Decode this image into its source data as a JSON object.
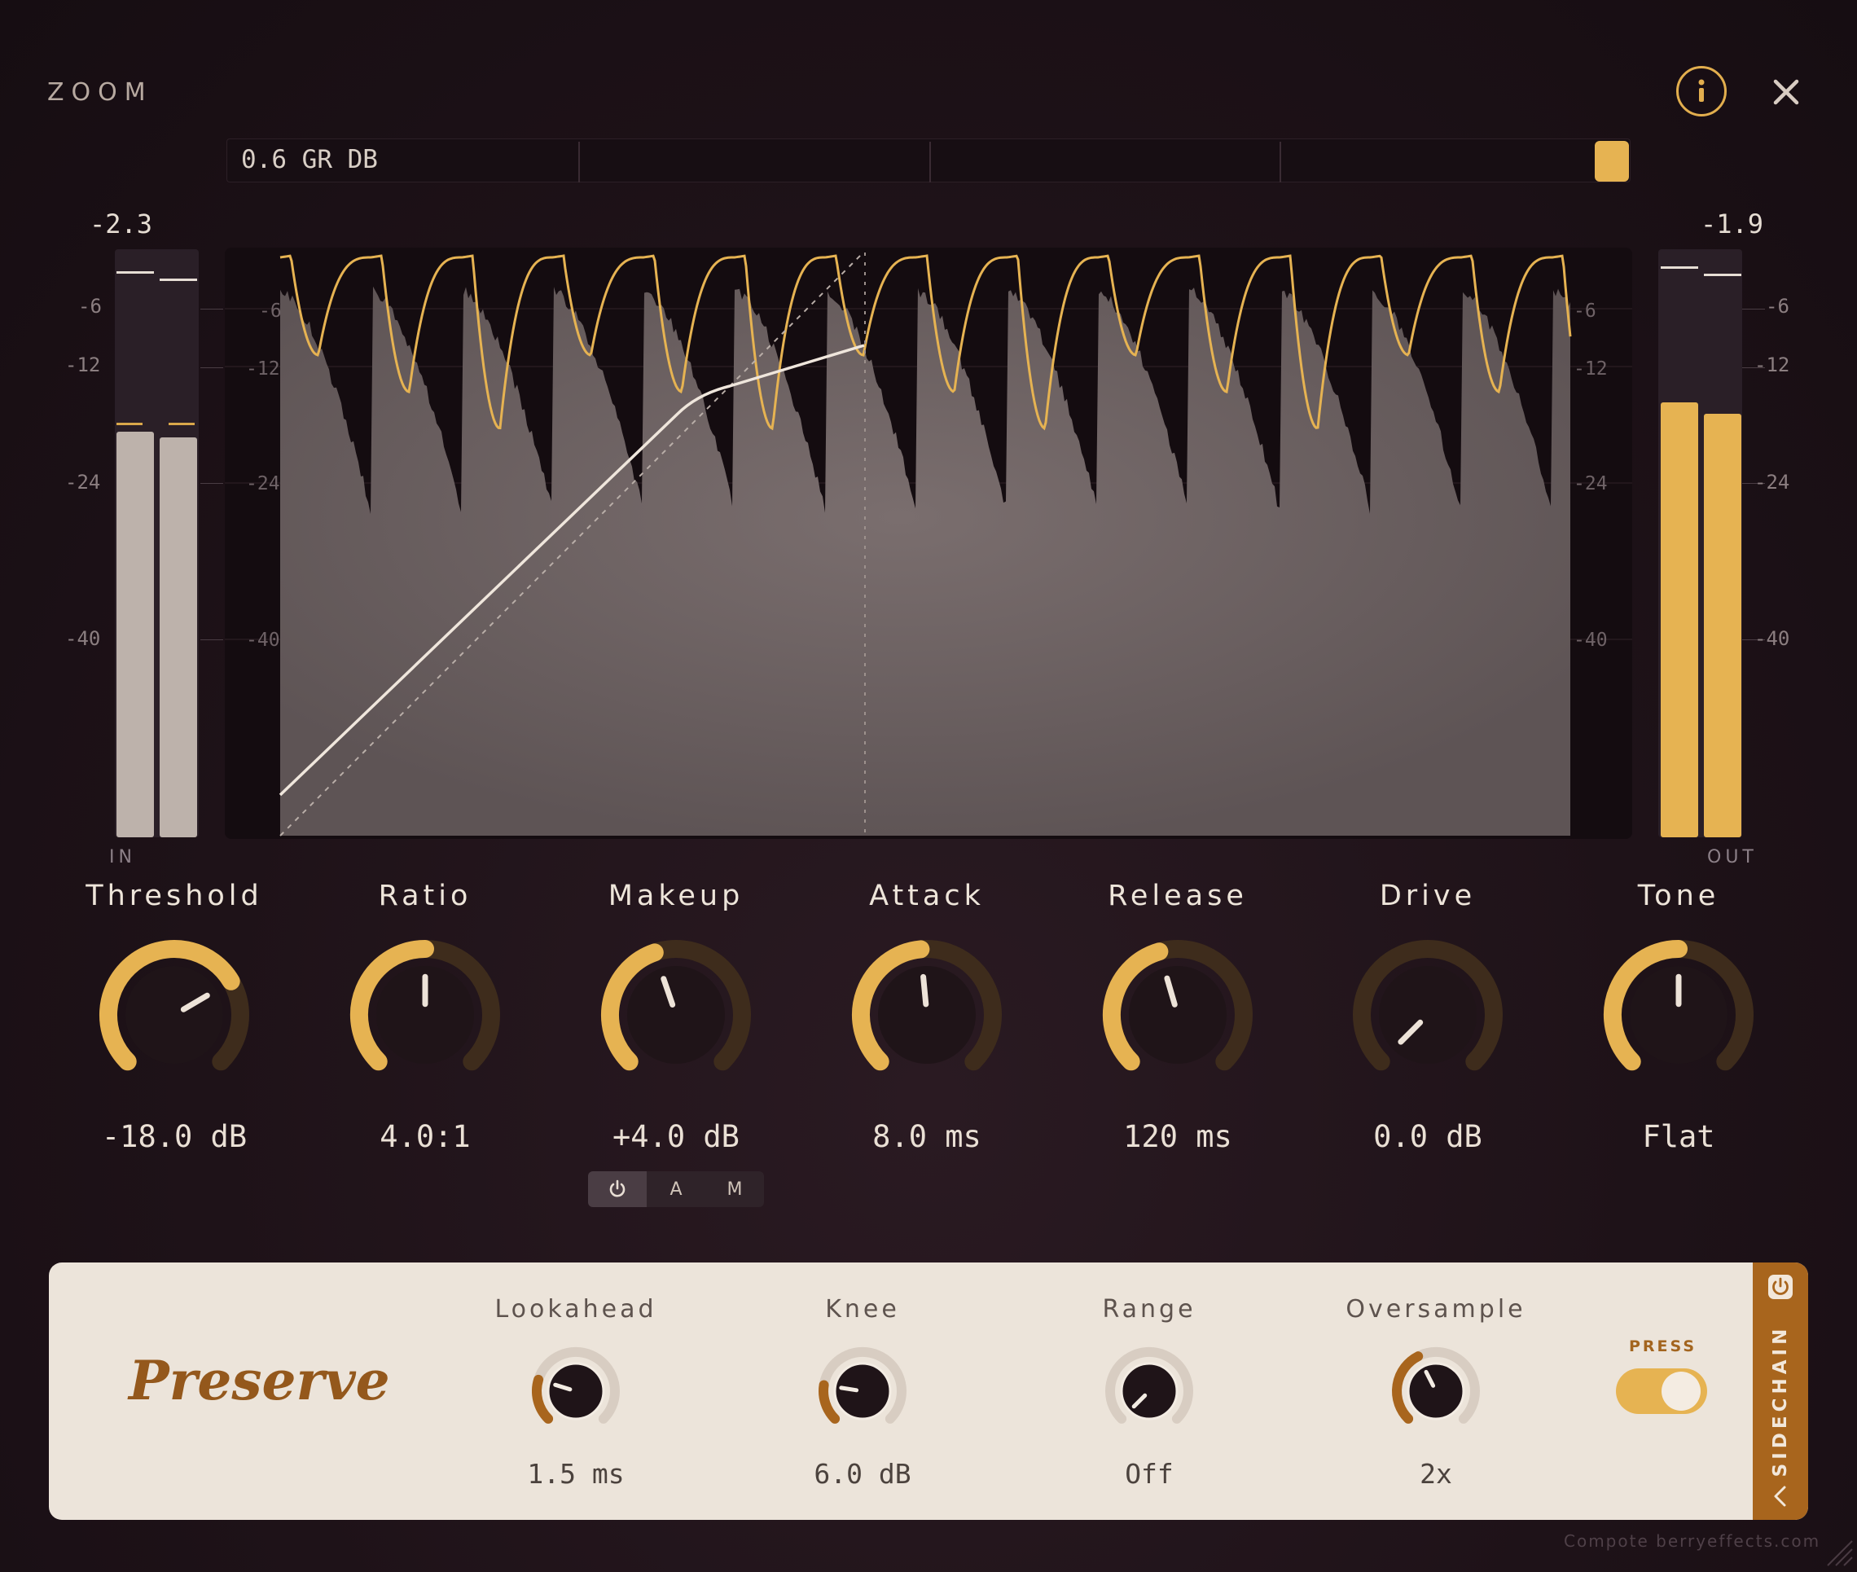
{
  "header": {
    "zoom_label": "ZOOM",
    "info_icon": "info-icon",
    "close_icon": "close-icon"
  },
  "gr_bar": {
    "text": "0.6 GR DB"
  },
  "meters": {
    "in": {
      "value": "-2.3",
      "label": "IN",
      "levels": [
        0.69,
        0.68
      ]
    },
    "out": {
      "value": "-1.9",
      "label": "OUT",
      "levels": [
        0.74,
        0.72
      ]
    },
    "scale": [
      "-6",
      "-12",
      "-24",
      "-40"
    ]
  },
  "knobs": [
    {
      "name": "threshold",
      "title": "Threshold",
      "value": "-18.0 dB",
      "fraction": 0.72
    },
    {
      "name": "ratio",
      "title": "Ratio",
      "value": "4.0:1",
      "fraction": 0.5
    },
    {
      "name": "makeup",
      "title": "Makeup",
      "value": "+4.0 dB",
      "fraction": 0.43
    },
    {
      "name": "attack",
      "title": "Attack",
      "value": "8.0 ms",
      "fraction": 0.48
    },
    {
      "name": "release",
      "title": "Release",
      "value": "120 ms",
      "fraction": 0.44
    },
    {
      "name": "drive",
      "title": "Drive",
      "value": "0.0 dB",
      "fraction": 0.0
    },
    {
      "name": "tone",
      "title": "Tone",
      "value": "Flat",
      "fraction": 0.5
    }
  ],
  "makeup_modes": {
    "power_icon": "power-icon",
    "a": "A",
    "m": "M"
  },
  "panel": {
    "mode_name": "Preserve",
    "knobs": [
      {
        "name": "lookahead",
        "title": "Lookahead",
        "value": "1.5 ms",
        "fraction": 0.23
      },
      {
        "name": "knee",
        "title": "Knee",
        "value": "6.0 dB",
        "fraction": 0.2
      },
      {
        "name": "range",
        "title": "Range",
        "value": "Off",
        "fraction": 0.0
      },
      {
        "name": "oversample",
        "title": "Oversample",
        "value": "2x",
        "fraction": 0.4
      }
    ],
    "press_label": "PRESS",
    "press_on": true,
    "sidechain_label": "SIDECHAIN"
  },
  "footer": "Compote  berryeffects.com",
  "colors": {
    "accent": "#e6b352",
    "panel": "#ece4da",
    "brand_brown": "#a8651d"
  }
}
